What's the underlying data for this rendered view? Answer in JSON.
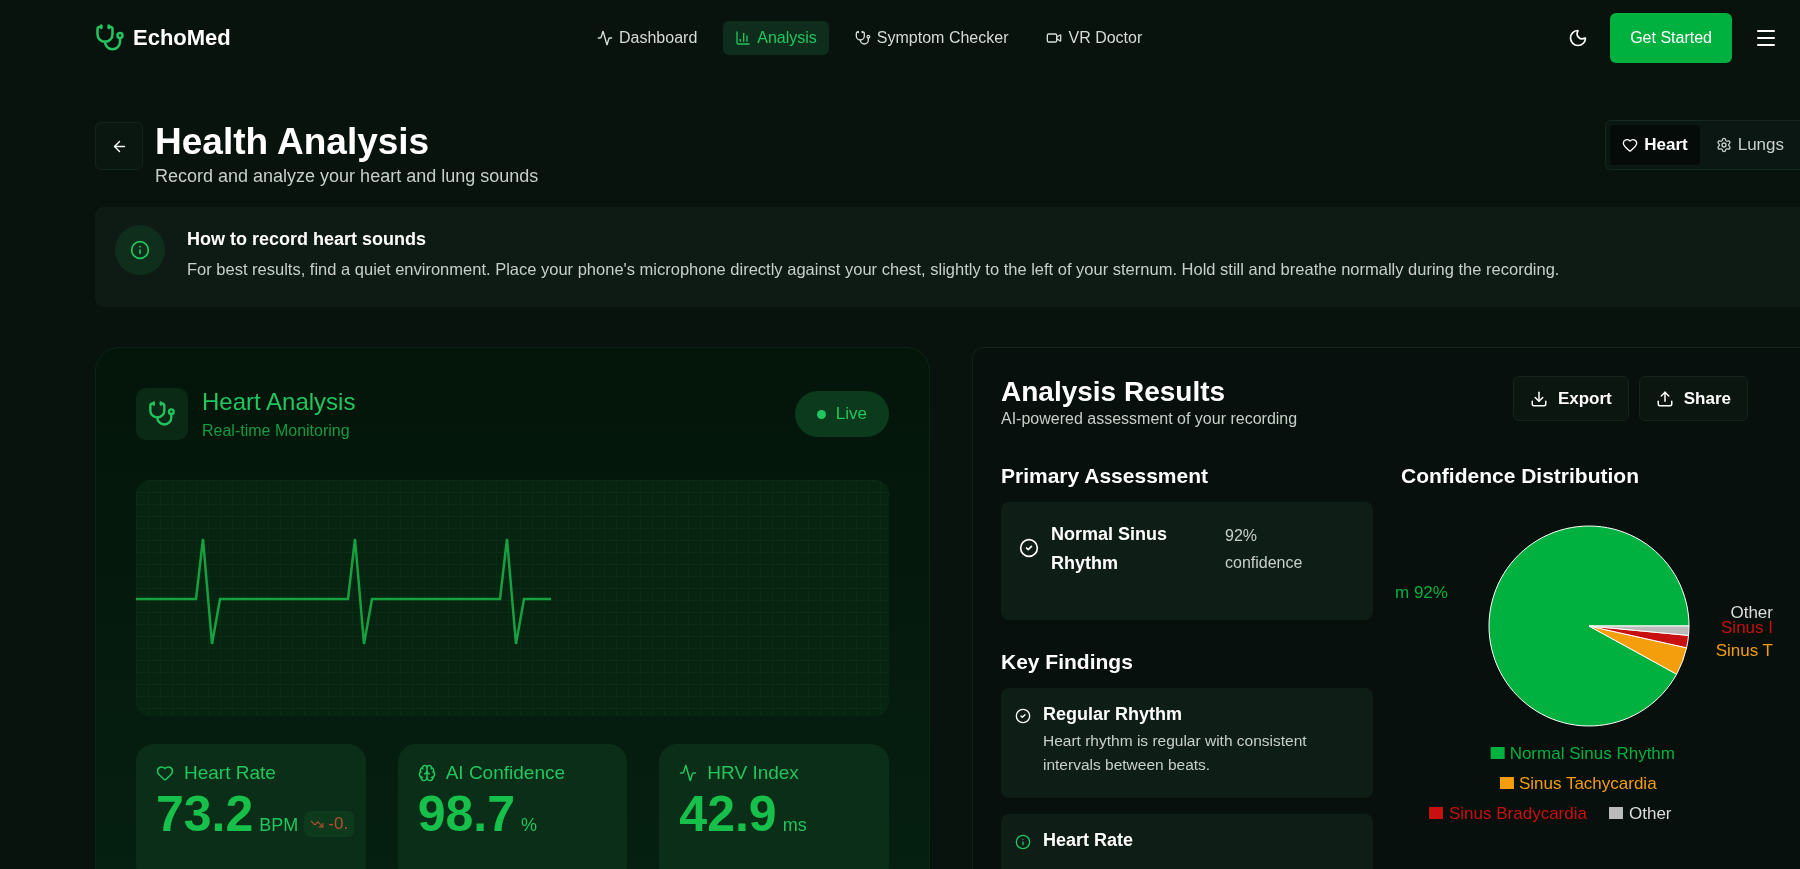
{
  "brand": {
    "name": "EchoMed"
  },
  "nav": [
    {
      "label": "Dashboard",
      "selected": false
    },
    {
      "label": "Analysis",
      "selected": true
    },
    {
      "label": "Symptom Checker",
      "selected": false
    },
    {
      "label": "VR Doctor",
      "selected": false
    }
  ],
  "cta": "Get Started",
  "header": {
    "title": "Health Analysis",
    "subtitle": "Record and analyze your heart and lung sounds"
  },
  "organ_tabs": [
    {
      "label": "Heart",
      "selected": true
    },
    {
      "label": "Lungs",
      "selected": false
    }
  ],
  "tip": {
    "title": "How to record heart sounds",
    "text": "For best results, find a quiet environment. Place your phone's microphone directly against your chest, slightly to the left of your sternum. Hold still and breathe normally during the recording."
  },
  "monitor": {
    "title": "Heart Analysis",
    "subtitle": "Real-time Monitoring",
    "status": "Live",
    "live": true,
    "stats": [
      {
        "label": "Heart Rate",
        "value": "73.2",
        "unit": "BPM",
        "trend": "-0."
      },
      {
        "label": "AI Confidence",
        "value": "98.7",
        "unit": "%"
      },
      {
        "label": "HRV Index",
        "value": "42.9",
        "unit": "ms"
      }
    ]
  },
  "results": {
    "title": "Analysis Results",
    "subtitle": "AI-powered assessment of your recording",
    "actions": [
      {
        "label": "Export"
      },
      {
        "label": "Share"
      }
    ],
    "primary_heading": "Primary Assessment",
    "primary": {
      "name": "Normal Sinus Rhythm",
      "confidence": "92% confidence"
    },
    "findings_heading": "Key Findings",
    "findings": [
      {
        "kind": "check",
        "title": "Regular Rhythm",
        "text": "Heart rhythm is regular with consistent intervals between beats."
      },
      {
        "kind": "info",
        "title": "Heart Rate"
      }
    ],
    "chart_heading": "Confidence Distribution",
    "chart_data": {
      "type": "pie",
      "categories": [
        "Normal Sinus Rhythm",
        "Sinus Tachycardia",
        "Sinus Bradycardia",
        "Other"
      ],
      "values": [
        92,
        4.5,
        2,
        1.5
      ],
      "colors": [
        "#00b140",
        "#f59e0b",
        "#c81010",
        "#bbbbbb"
      ],
      "legend": "bottom",
      "annotations": [
        "m 92%",
        "Sinus T",
        "Sinus I",
        "Other"
      ]
    }
  }
}
